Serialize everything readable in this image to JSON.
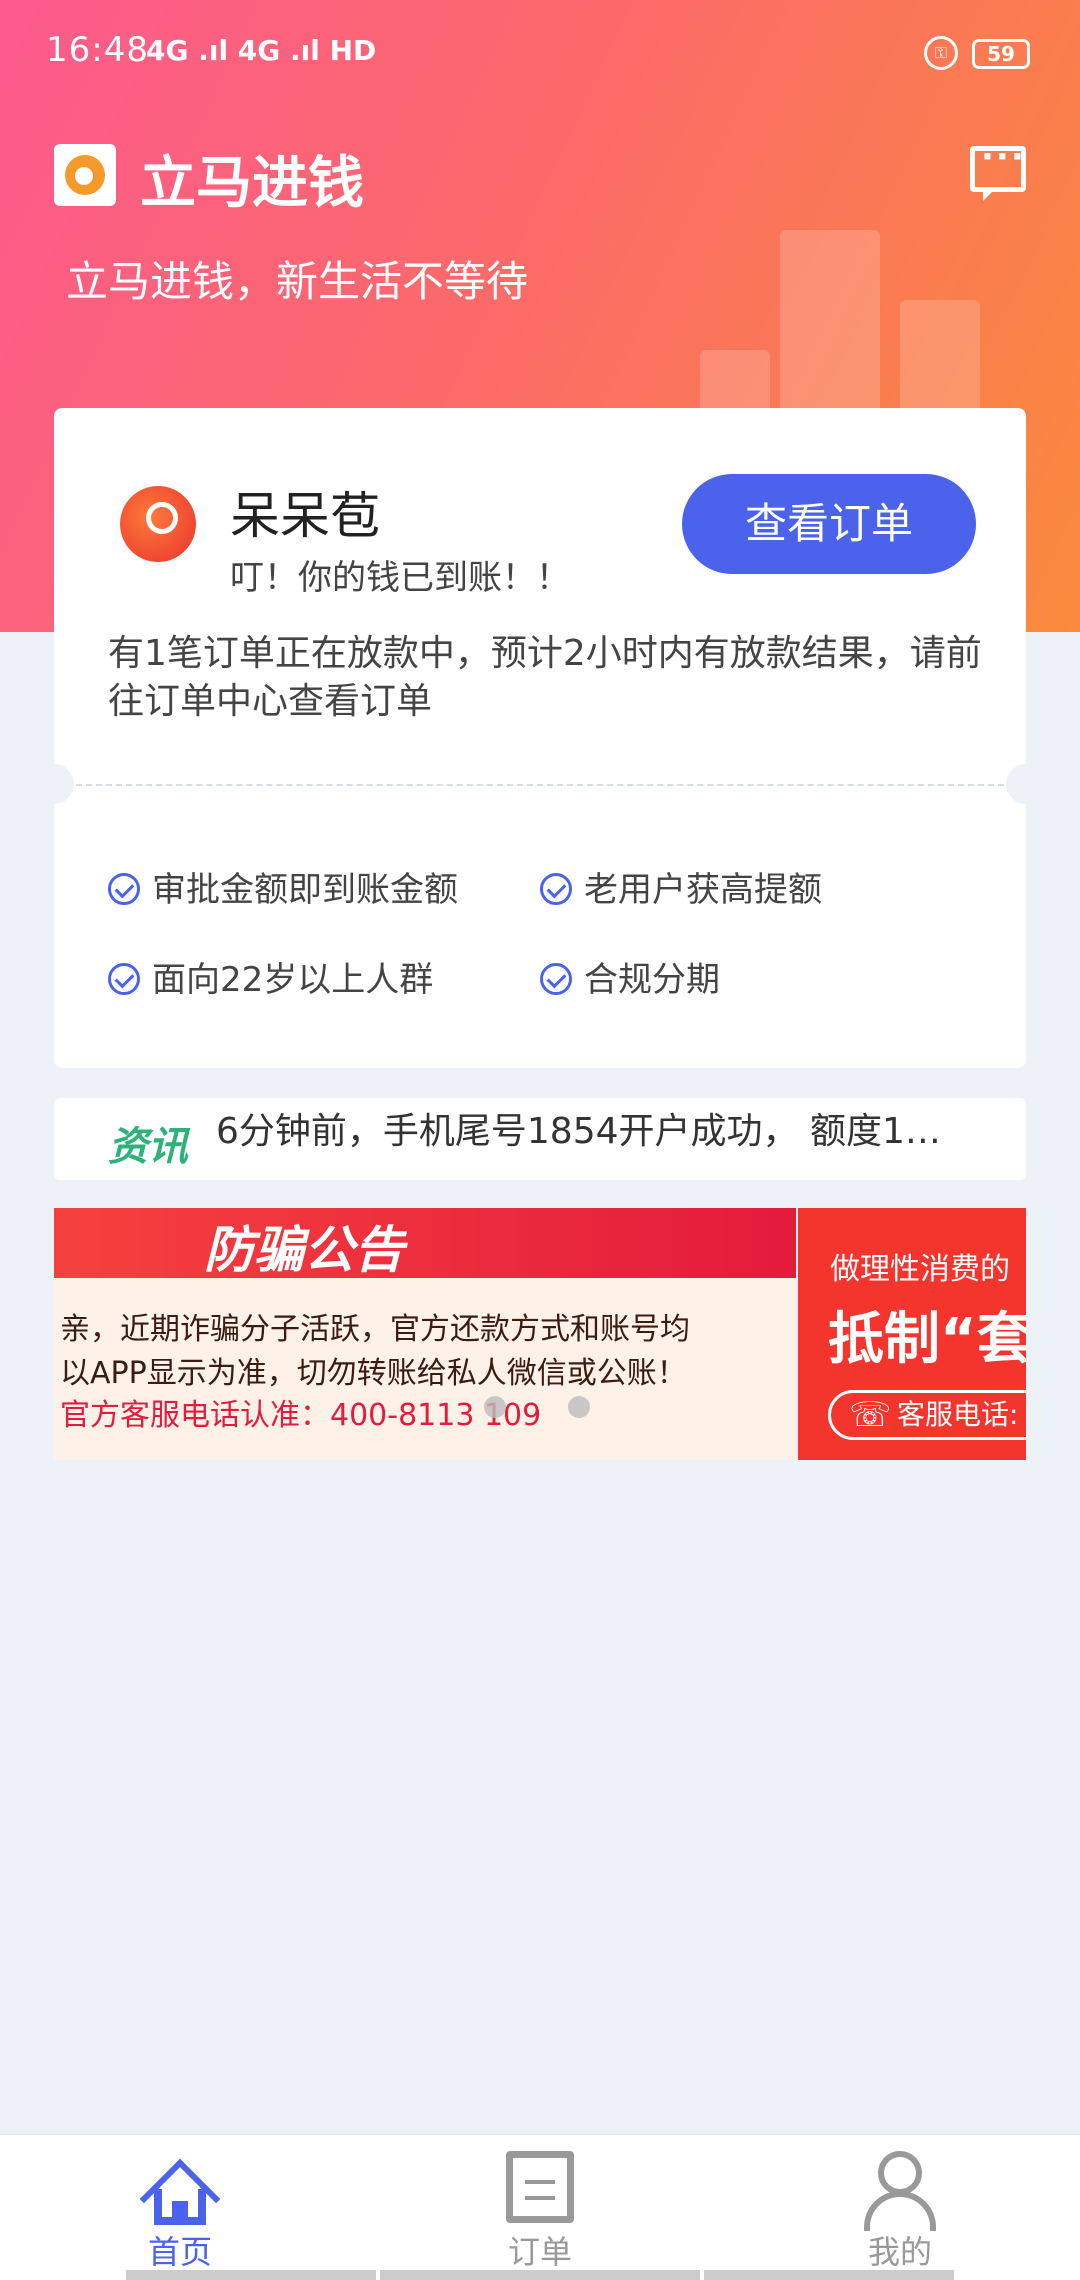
{
  "status_bar": {
    "time": "16:48",
    "network": "4G .ıl 4G .ıl HD",
    "battery": "59"
  },
  "header": {
    "app_title": "立马进钱",
    "slogan": "立马进钱，新生活不等待"
  },
  "order_card": {
    "product_name": "呆呆苞",
    "product_message": "叮！你的钱已到账！！",
    "button_label": "查看订单",
    "notice": "有1笔订单正在放款中，预计2小时内有放款结果，请前往订单中心查看订单",
    "features": [
      "审批金额即到账金额",
      "老用户获高提额",
      "面向22岁以上人群",
      "合规分期"
    ]
  },
  "news": {
    "tag": "资讯",
    "text": "6分钟前，手机尾号1854开户成功， 额度1…"
  },
  "banner": {
    "title": "防骗公告",
    "line1": "亲，近期诈骗分子活跃，官方还款方式和账号均",
    "line2": "以APP显示为准，切勿转账给私人微信或公账！",
    "phone": "官方客服电话认准：400-8113 109",
    "side_line1": "做理性消费的",
    "side_line2": "抵制“套",
    "side_line3": "客服电话:"
  },
  "tabbar": {
    "tabs": [
      {
        "label": "首页"
      },
      {
        "label": "订单"
      },
      {
        "label": "我的"
      }
    ]
  },
  "colors": {
    "accent": "#4b63ea",
    "header_gradient_start": "#fc5a8d",
    "header_gradient_end": "#fa8a3c",
    "news_tag": "#2fb27a"
  }
}
